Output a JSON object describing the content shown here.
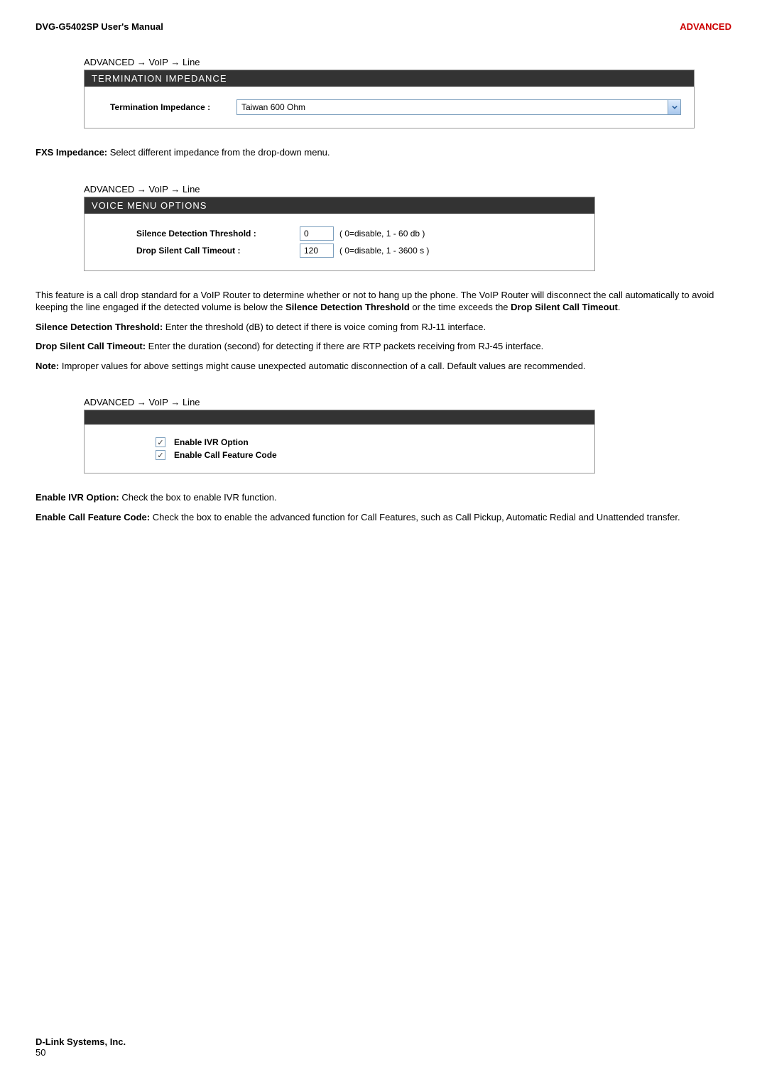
{
  "header": {
    "left": "DVG-G5402SP User's Manual",
    "right": "ADVANCED"
  },
  "breadcrumb": "ADVANCED  →  VoIP  →  Line",
  "term_panel": {
    "title": "TERMINATION IMPEDANCE",
    "label": "Termination Impedance :",
    "value": "Taiwan  600 Ohm"
  },
  "fxs_text": {
    "label": "FXS Impedance: ",
    "body": "Select different impedance from the drop-down menu."
  },
  "voice_panel": {
    "title": "VOICE MENU OPTIONS",
    "row1": {
      "label": "Silence Detection Threshold :",
      "value": "0",
      "hint": "( 0=disable, 1 - 60 db )"
    },
    "row2": {
      "label": "Drop Silent Call Timeout :",
      "value": "120",
      "hint": "( 0=disable, 1 - 3600 s )"
    }
  },
  "voice_para1": {
    "p1a": "This feature is a call drop standard for a VoIP Router to determine whether or not to hang up the phone. The VoIP Router will disconnect the call automatically to avoid keeping the line engaged if the detected volume is below the ",
    "p1b": "Silence Detection Threshold",
    "p1c": " or the time exceeds the ",
    "p1d": "Drop Silent Call Timeout",
    "p1e": "."
  },
  "sdt": {
    "label": "Silence Detection Threshold: ",
    "body": "Enter the threshold (dB) to detect if there is voice coming from RJ-11 interface."
  },
  "dsct": {
    "label": "Drop Silent Call Timeout: ",
    "body": "Enter the duration (second) for detecting if there are RTP packets receiving from RJ-45 interface."
  },
  "note": {
    "label": "Note: ",
    "body": "Improper values for above settings might cause unexpected automatic disconnection of a call. Default values are recommended."
  },
  "options_panel": {
    "row1": "Enable IVR Option",
    "row2": "Enable Call Feature Code"
  },
  "ivr": {
    "label": "Enable IVR Option: ",
    "body": "Check the box to enable IVR function."
  },
  "ecfc": {
    "label": "Enable Call Feature Code: ",
    "body": "Check the box to enable the advanced function for Call Features, such as Call Pickup, Automatic Redial and Unattended transfer."
  },
  "footer": {
    "company": "D-Link Systems, Inc.",
    "page": "50"
  },
  "checkmark": "✓"
}
